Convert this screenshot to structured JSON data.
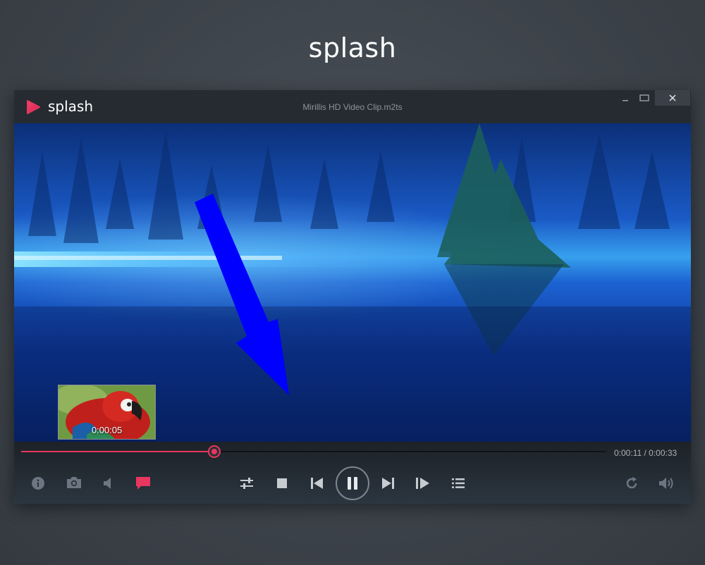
{
  "page": {
    "brand": "splash"
  },
  "window": {
    "brand": "splash",
    "file_title": "Mirillis HD Video Clip.m2ts",
    "controls": {
      "minimize": "–",
      "maximize": "□",
      "close": "✕"
    }
  },
  "video": {
    "preview": {
      "time": "0:00:05"
    }
  },
  "player": {
    "progress_fraction": 0.33,
    "current_time": "0:00:11",
    "duration": "0:00:33",
    "time_display": "0:00:11 / 0:00:33",
    "left_buttons": [
      "info-icon",
      "camera-icon",
      "audio-track-icon",
      "subtitles-icon"
    ],
    "center_buttons": [
      "equalizer-icon",
      "stop-icon",
      "previous-icon",
      "pause-icon",
      "next-icon",
      "frame-step-icon",
      "playlist-icon"
    ],
    "right_buttons": [
      "repeat-icon",
      "volume-icon"
    ]
  },
  "colors": {
    "accent": "#e8365f",
    "icon": "#c7ccd1",
    "icon_dim": "#6c7680",
    "background": "#3d434a",
    "titlebar": "#262b31",
    "video_blue": "#1a57c9",
    "arrow": "#0000ff"
  }
}
